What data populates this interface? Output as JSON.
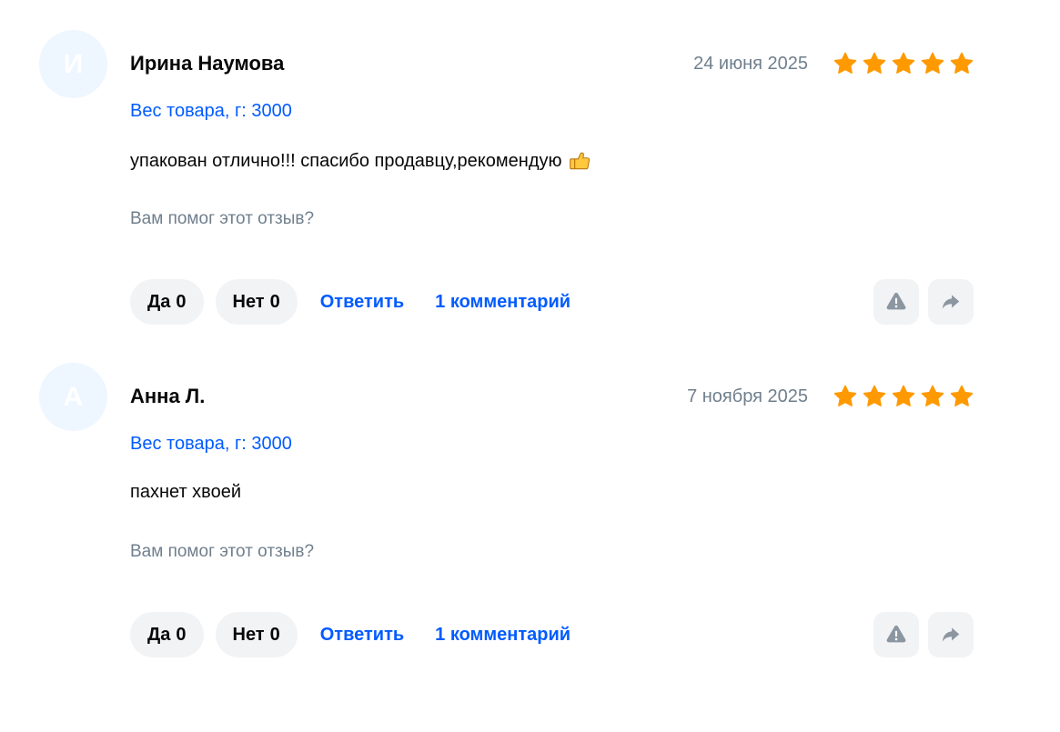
{
  "colors": {
    "accent": "#005bff",
    "star": "#ff9900",
    "muted": "#707f8d",
    "avatar_bg": "#eef6ff",
    "button_bg": "#f2f3f5"
  },
  "helpful_question": "Вам помог этот отзыв?",
  "reviews": [
    {
      "initial": "И",
      "author": "Ирина Наумова",
      "date": "24 июня 2025",
      "rating": 5,
      "variant": "Вес товара, г: 3000",
      "text": "упакован отлично!!! спасибо продавцу,рекомендую",
      "emoji_icon": "thumbs-up-icon",
      "yes_label": "Да",
      "yes_count": "0",
      "no_label": "Нет",
      "no_count": "0",
      "reply_label": "Ответить",
      "comments_label": "1 комментарий",
      "report_icon": "warning-icon",
      "share_icon": "share-arrow-icon"
    },
    {
      "initial": "А",
      "author": "Анна Л.",
      "date": "7 ноября 2025",
      "rating": 5,
      "variant": "Вес товара, г: 3000",
      "text": "пахнет хвоей",
      "emoji_icon": "",
      "yes_label": "Да",
      "yes_count": "0",
      "no_label": "Нет",
      "no_count": "0",
      "reply_label": "Ответить",
      "comments_label": "1 комментарий",
      "report_icon": "warning-icon",
      "share_icon": "share-arrow-icon"
    }
  ]
}
